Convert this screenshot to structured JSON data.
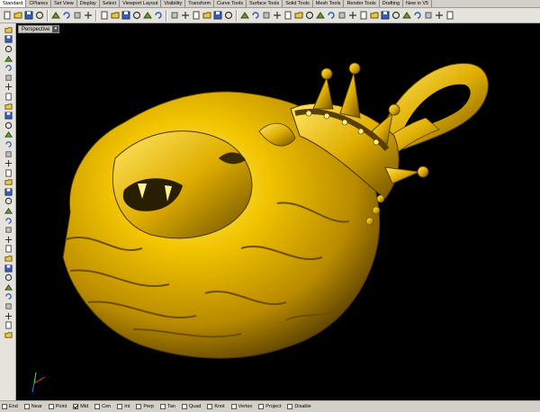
{
  "tabs": [
    {
      "label": "Standard",
      "active": true
    },
    {
      "label": "CPlanes"
    },
    {
      "label": "Set View"
    },
    {
      "label": "Display"
    },
    {
      "label": "Select"
    },
    {
      "label": "Viewport Layout"
    },
    {
      "label": "Visibility"
    },
    {
      "label": "Transform"
    },
    {
      "label": "Curve Tools"
    },
    {
      "label": "Surface Tools"
    },
    {
      "label": "Solid Tools"
    },
    {
      "label": "Mesh Tools"
    },
    {
      "label": "Render Tools"
    },
    {
      "label": "Drafting"
    },
    {
      "label": "New in V5"
    }
  ],
  "viewport": {
    "label": "Perspective",
    "background": "#000000",
    "model_color": "#e8b800"
  },
  "osnaps": [
    {
      "label": "End",
      "checked": false
    },
    {
      "label": "Near",
      "checked": false
    },
    {
      "label": "Point",
      "checked": false
    },
    {
      "label": "Mid",
      "checked": true
    },
    {
      "label": "Cen",
      "checked": false
    },
    {
      "label": "Int",
      "checked": false
    },
    {
      "label": "Perp",
      "checked": false
    },
    {
      "label": "Tan",
      "checked": false
    },
    {
      "label": "Quad",
      "checked": false
    },
    {
      "label": "Knot",
      "checked": false
    },
    {
      "label": "Vertex",
      "checked": false
    },
    {
      "label": "Project",
      "checked": false
    },
    {
      "label": "Disable",
      "checked": false
    }
  ],
  "toolbar_icons": [
    "new-file-icon",
    "open-icon",
    "save-icon",
    "print-icon",
    "cut-icon",
    "copy-icon",
    "paste-icon",
    "undo-icon",
    "hand-pan-icon",
    "rotate-view-icon",
    "zoom-icon",
    "zoom-window-icon",
    "zoom-extents-icon",
    "zoom-selected-icon",
    "grid-icon",
    "four-views-icon",
    "camera-icon",
    "lock-icon",
    "layer-icon",
    "properties-icon",
    "light-icon",
    "sphere-icon",
    "render-icon",
    "material-icon",
    "gear-icon",
    "help-icon"
  ],
  "left_icons": [
    "select-icon",
    "point-icon",
    "polyline-icon",
    "curve-icon",
    "circle-icon",
    "arc-icon",
    "ellipse-icon",
    "rectangle-icon",
    "polygon-icon",
    "text-icon",
    "fillet-icon",
    "surface-icon",
    "box-icon",
    "sphere-icon",
    "cylinder-icon",
    "extrude-icon",
    "mesh-icon",
    "boolean-icon",
    "join-icon",
    "explode-icon",
    "trim-icon",
    "split-icon",
    "group-icon",
    "move-icon",
    "copy-icon",
    "rotate-icon",
    "scale-icon",
    "mirror-icon",
    "array-icon",
    "dimension-icon",
    "analyze-icon",
    "render-icon",
    "gear-icon"
  ]
}
